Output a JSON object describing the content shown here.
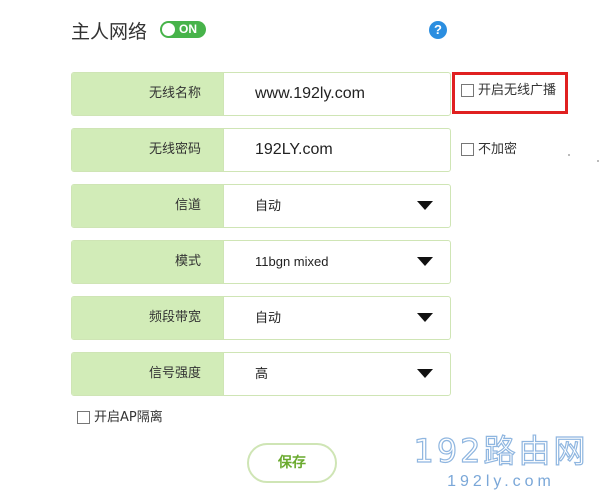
{
  "header": {
    "title": "主人网络",
    "toggle_label": "ON",
    "help_label": "?"
  },
  "form": {
    "rows": [
      {
        "label": "无线名称",
        "value": "www.192ly.com"
      },
      {
        "label": "无线密码",
        "value": "192LY.com"
      },
      {
        "label": "信道",
        "value": "自动"
      },
      {
        "label": "模式",
        "value": "11bgn mixed"
      },
      {
        "label": "频段带宽",
        "value": "自动"
      },
      {
        "label": "信号强度",
        "value": "高"
      }
    ],
    "ssid_broadcast_label": "开启无线广播",
    "no_encrypt_label": "不加密",
    "ap_isolation_label": "开启AP隔离",
    "save_label": "保存"
  },
  "watermark": {
    "line1": "192路由网",
    "line2": "192ly.com"
  },
  "colors": {
    "accent_green": "#47b34a",
    "label_bg": "#d2ecb8",
    "help_blue": "#2b8ee0",
    "highlight_red": "#e02020"
  }
}
